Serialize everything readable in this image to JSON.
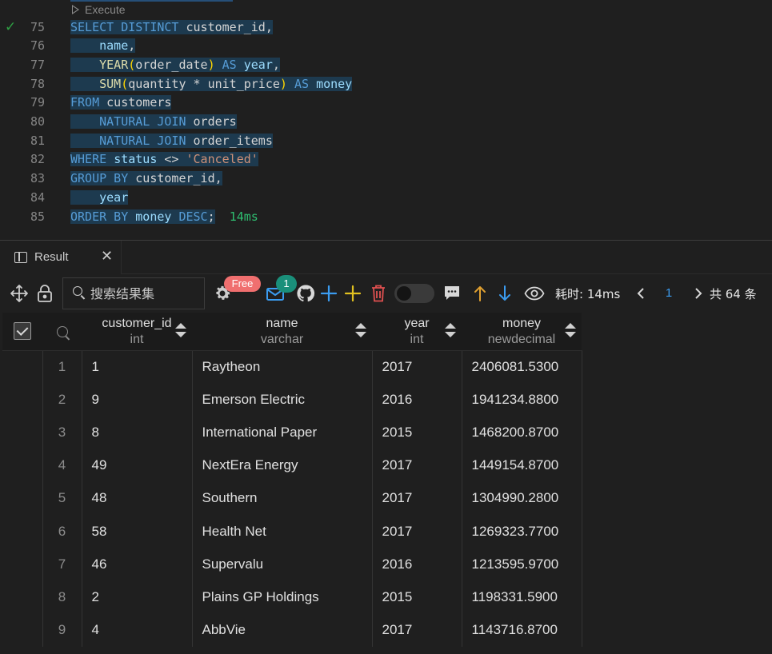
{
  "editor": {
    "codelens_label": "Execute",
    "lines": [
      {
        "num": "75",
        "status": "success",
        "tokens": [
          [
            "kw",
            "SELECT DISTINCT "
          ],
          [
            "pl",
            "customer_id,"
          ]
        ]
      },
      {
        "num": "76",
        "tokens": [
          [
            "pl",
            "    "
          ],
          [
            "id",
            "name"
          ],
          [
            "pl",
            ","
          ]
        ]
      },
      {
        "num": "77",
        "tokens": [
          [
            "pl",
            "    "
          ],
          [
            "fn",
            "YEAR"
          ],
          [
            "paren",
            "("
          ],
          [
            "pl",
            "order_date"
          ],
          [
            "paren",
            ")"
          ],
          [
            "pl",
            " "
          ],
          [
            "kw",
            "AS"
          ],
          [
            "pl",
            " "
          ],
          [
            "id",
            "year"
          ],
          [
            "pl",
            ","
          ]
        ]
      },
      {
        "num": "78",
        "tokens": [
          [
            "pl",
            "    "
          ],
          [
            "fn",
            "SUM"
          ],
          [
            "paren",
            "("
          ],
          [
            "pl",
            "quantity * unit_price"
          ],
          [
            "paren",
            ")"
          ],
          [
            "pl",
            " "
          ],
          [
            "kw",
            "AS"
          ],
          [
            "pl",
            " "
          ],
          [
            "id",
            "money"
          ]
        ]
      },
      {
        "num": "79",
        "tokens": [
          [
            "kw",
            "FROM"
          ],
          [
            "pl",
            " customers"
          ]
        ]
      },
      {
        "num": "80",
        "tokens": [
          [
            "pl",
            "    "
          ],
          [
            "kw",
            "NATURAL JOIN"
          ],
          [
            "pl",
            " orders"
          ]
        ]
      },
      {
        "num": "81",
        "tokens": [
          [
            "pl",
            "    "
          ],
          [
            "kw",
            "NATURAL JOIN"
          ],
          [
            "pl",
            " order_items"
          ]
        ]
      },
      {
        "num": "82",
        "tokens": [
          [
            "kw",
            "WHERE"
          ],
          [
            "pl",
            " "
          ],
          [
            "id",
            "status"
          ],
          [
            "pl",
            " <> "
          ],
          [
            "str",
            "'Canceled'"
          ]
        ]
      },
      {
        "num": "83",
        "tokens": [
          [
            "kw",
            "GROUP BY"
          ],
          [
            "pl",
            " customer_id,"
          ]
        ]
      },
      {
        "num": "84",
        "tokens": [
          [
            "pl",
            "    "
          ],
          [
            "id",
            "year"
          ]
        ]
      },
      {
        "num": "85",
        "tokens": [
          [
            "kw",
            "ORDER BY"
          ],
          [
            "pl",
            " "
          ],
          [
            "id",
            "money"
          ],
          [
            "pl",
            " "
          ],
          [
            "kw",
            "DESC"
          ],
          [
            "pl",
            ";"
          ]
        ],
        "suffix": "14ms"
      }
    ]
  },
  "panel": {
    "tab_label": "Result",
    "close_glyph": "✕"
  },
  "toolbar": {
    "search_placeholder": "搜索结果集",
    "free_badge": "Free",
    "mail_badge": "1",
    "elapsed": "耗时: 14ms",
    "page": "1",
    "total": "共 64 条",
    "colors": {
      "plus_blue": "#3b9cf0",
      "plus_yellow": "#e0c020",
      "trash_red": "#e05050",
      "arrow_up": "#e0a030",
      "arrow_down": "#3b9cf0",
      "page_blue": "#3b9cf0"
    }
  },
  "table": {
    "columns": [
      {
        "name": "customer_id",
        "type": "int"
      },
      {
        "name": "name",
        "type": "varchar"
      },
      {
        "name": "year",
        "type": "int"
      },
      {
        "name": "money",
        "type": "newdecimal"
      }
    ],
    "rows": [
      [
        "1",
        "1",
        "Raytheon",
        "2017",
        "2406081.5300"
      ],
      [
        "2",
        "9",
        "Emerson Electric",
        "2016",
        "1941234.8800"
      ],
      [
        "3",
        "8",
        "International Paper",
        "2015",
        "1468200.8700"
      ],
      [
        "4",
        "49",
        "NextEra Energy",
        "2017",
        "1449154.8700"
      ],
      [
        "5",
        "48",
        "Southern",
        "2017",
        "1304990.2800"
      ],
      [
        "6",
        "58",
        "Health Net",
        "2017",
        "1269323.7700"
      ],
      [
        "7",
        "46",
        "Supervalu",
        "2016",
        "1213595.9700"
      ],
      [
        "8",
        "2",
        "Plains GP Holdings",
        "2015",
        "1198331.5900"
      ],
      [
        "9",
        "4",
        "AbbVie",
        "2017",
        "1143716.8700"
      ]
    ]
  }
}
